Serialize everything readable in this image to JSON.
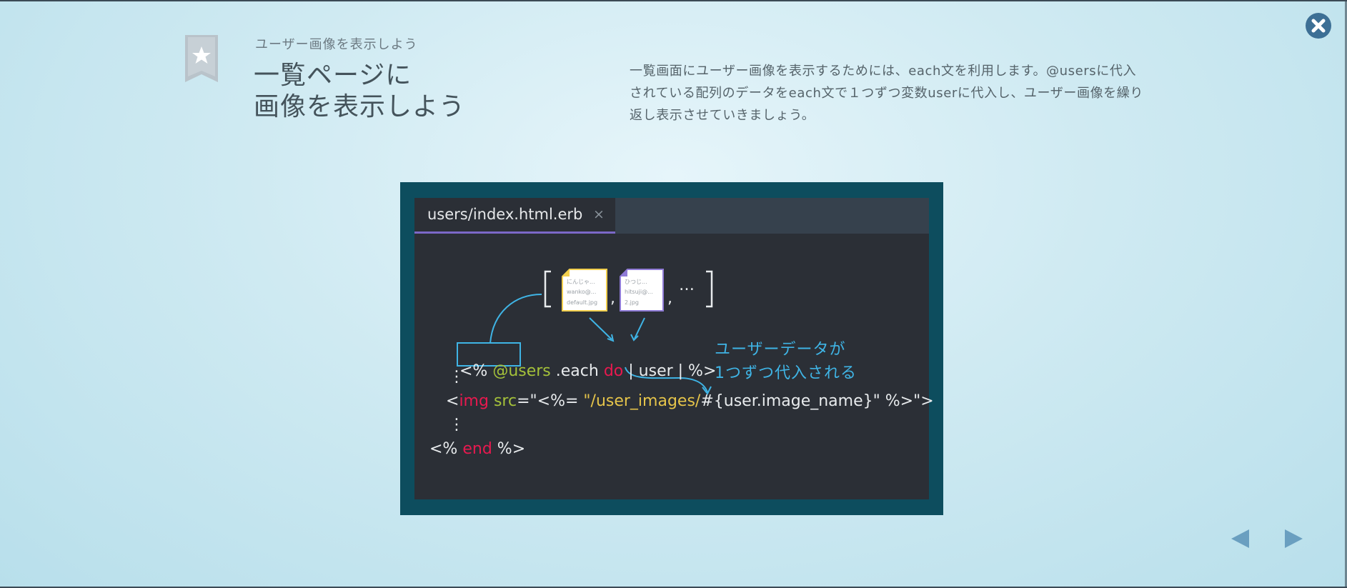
{
  "header": {
    "subtitle": "ユーザー画像を表示しよう",
    "title_line1": "一覧ページに",
    "title_line2": "画像を表示しよう",
    "description": "一覧画面にユーザー画像を表示するためには、each文を利用します。@usersに代入されている配列のデータをeach文で１つずつ変数userに代入し、ユーザー画像を繰り返し表示させていきましょう。"
  },
  "editor": {
    "tab_label": "users/index.html.erb",
    "tab_close": "×",
    "code": {
      "line1_open": "<%",
      "line1_var": "@users",
      "line1_each": ".each",
      "line1_do": "do",
      "line1_block": "| user | %>",
      "line2_dots": "⋮",
      "line3_lt": "<",
      "line3_img": "img",
      "line3_src": "src",
      "line3_eq": "=\"<%=",
      "line3_str": "\"/user_images/",
      "line3_interp": "#{user.image_name}\" %>\">",
      "line4_dots": "⋮",
      "line5_open": "<%",
      "line5_end": "end",
      "line5_close": "%>"
    },
    "array_illustration": {
      "doc1_lines": [
        "にんじゃ...",
        "wanko@...",
        "default.jpg"
      ],
      "doc2_lines": [
        "ひつじ...",
        "hitsuji@...",
        "2.jpg"
      ],
      "comma": ",",
      "ellipsis": "…",
      "doc1_color": "#f2cf4e",
      "doc2_color": "#8f7bd6"
    },
    "annotation_line1": "ユーザーデータが",
    "annotation_line2": "1つずつ代入される"
  },
  "colors": {
    "accent_blue": "#3fb4e5",
    "keyword_red": "#e8194f",
    "var_green": "#a4c13a",
    "string_yellow": "#e5c44a",
    "tab_underline": "#7b68c8",
    "frame": "#0d4d5e"
  },
  "icons": {
    "bookmark": "star-bookmark-icon",
    "close": "close-icon",
    "prev": "arrow-left-icon",
    "next": "arrow-right-icon"
  }
}
